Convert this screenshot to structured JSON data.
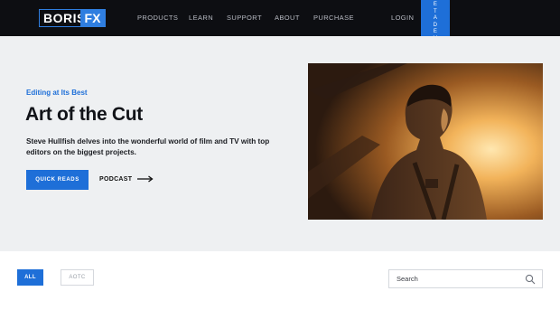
{
  "brand": {
    "logo_main": "BORIS",
    "logo_fx": "FX"
  },
  "nav": {
    "items": [
      "PRODUCTS",
      "LEARN",
      "SUPPORT",
      "ABOUT",
      "PURCHASE"
    ],
    "login": "LOGIN",
    "demo_letters": [
      "E",
      "T",
      "A",
      "D",
      "E",
      "M",
      "O"
    ]
  },
  "hero": {
    "eyebrow": "Editing at Its Best",
    "title": "Art of the Cut",
    "description": "Steve Hullfish delves into the wonderful world of film and TV with top editors on the biggest projects.",
    "primary_button": "QUICK READS",
    "secondary_link": "PODCAST"
  },
  "filters": {
    "chips": [
      "ALL",
      "AOTC"
    ],
    "active": "ALL"
  },
  "search": {
    "placeholder": "Search"
  },
  "colors": {
    "accent": "#1e6fd8",
    "nav_bg": "#0d0e12",
    "hero_bg": "#eef0f2"
  },
  "icons": {
    "arrow": "arrow-right-icon",
    "search": "search-icon"
  }
}
